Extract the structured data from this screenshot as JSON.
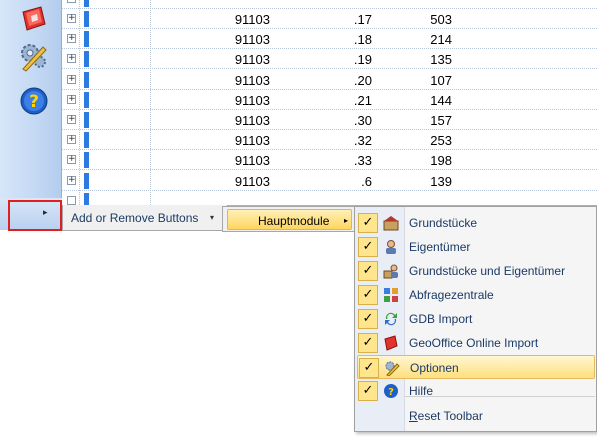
{
  "navbar": {
    "buttons": [
      {
        "name": "geooffice-online"
      },
      {
        "name": "options"
      },
      {
        "name": "help",
        "glyph": "?"
      }
    ],
    "chevron_glyph": "▸"
  },
  "grid": {
    "rows": [
      {
        "c1": "91103",
        "c2": ".17",
        "c3": "503"
      },
      {
        "c1": "91103",
        "c2": ".18",
        "c3": "214"
      },
      {
        "c1": "91103",
        "c2": ".19",
        "c3": "135"
      },
      {
        "c1": "91103",
        "c2": ".20",
        "c3": "107"
      },
      {
        "c1": "91103",
        "c2": ".21",
        "c3": "144"
      },
      {
        "c1": "91103",
        "c2": ".30",
        "c3": "157"
      },
      {
        "c1": "91103",
        "c2": ".32",
        "c3": "253"
      },
      {
        "c1": "91103",
        "c2": ".33",
        "c3": "198"
      },
      {
        "c1": "91103",
        "c2": ".6",
        "c3": "139"
      }
    ],
    "expander_glyph": "+"
  },
  "menus": {
    "add_remove": {
      "label": "Add or Remove Buttons",
      "arrow": "▾"
    },
    "hauptmodule": {
      "label": "Hauptmodule",
      "arrow": "▸"
    },
    "submenu": {
      "items": [
        {
          "label": "Grundstücke",
          "checked": true,
          "check_glyph": "✓",
          "icon": "parcel-icon"
        },
        {
          "label": "Eigentümer",
          "checked": true,
          "check_glyph": "✓",
          "icon": "owner-icon"
        },
        {
          "label": "Grundstücke und Eigentümer",
          "checked": true,
          "check_glyph": "✓",
          "icon": "parcel-owner-icon"
        },
        {
          "label": "Abfragezentrale",
          "checked": true,
          "check_glyph": "✓",
          "icon": "query-icon"
        },
        {
          "label": "GDB Import",
          "checked": true,
          "check_glyph": "✓",
          "icon": "import-icon"
        },
        {
          "label": "GeoOffice Online Import",
          "checked": true,
          "check_glyph": "✓",
          "icon": "geooffice-icon"
        },
        {
          "label": "Optionen",
          "checked": true,
          "check_glyph": "✓",
          "icon": "options-icon",
          "selected": true
        },
        {
          "label": "Hilfe",
          "checked": true,
          "check_glyph": "✓",
          "icon": "help-icon"
        }
      ],
      "reset": {
        "label": "Reset Toolbar"
      }
    }
  },
  "colors": {
    "highlight_border": "#e02020",
    "selected_fill": "#ffdf7e",
    "marker_blue": "#2b7be0"
  }
}
